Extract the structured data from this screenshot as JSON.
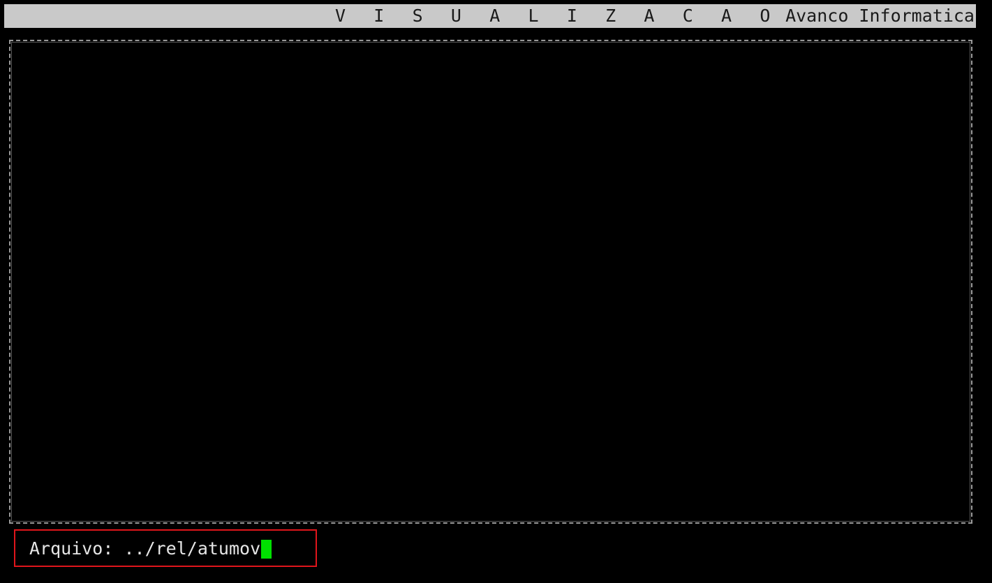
{
  "header": {
    "title": "V I S U A L I Z A C A O",
    "company": "Avanco Informatica"
  },
  "prompt": {
    "label": "Arquivo: ",
    "value": "../rel/atumov"
  },
  "colors": {
    "background": "#000000",
    "title_bar": "#c9c9c9",
    "cursor": "#00e000",
    "highlight_border": "#e0151b"
  }
}
